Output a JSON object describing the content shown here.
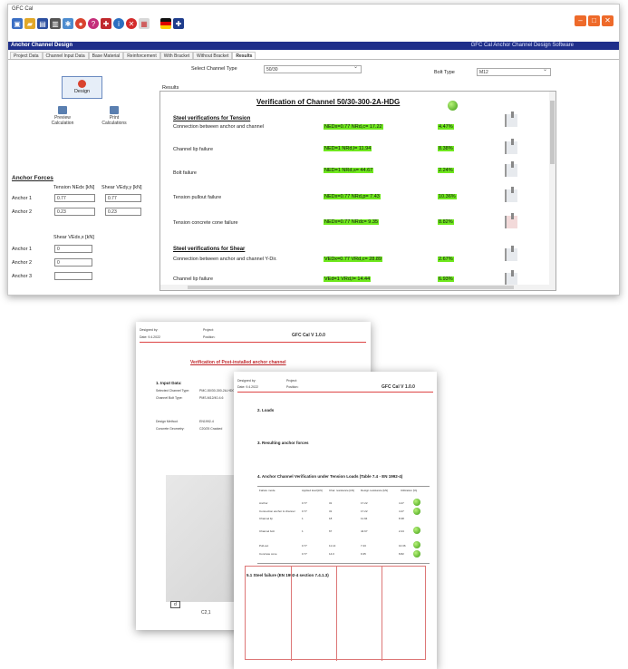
{
  "window": {
    "title": "GFC Cal"
  },
  "header": {
    "app_title": "Anchor Channel Design",
    "right_title": "GFC Cal Anchor Channel Design Software"
  },
  "tabs": [
    "Project Data",
    "Channel Input Data",
    "Base Material",
    "Reinforcement",
    "With Bracket",
    "Without Bracket",
    "Results"
  ],
  "selectors": {
    "channel_label": "Select Channel Type",
    "channel_value": "50/30",
    "bolt_label": "Bolt Type",
    "bolt_value": "M12"
  },
  "buttons": {
    "design": "Design",
    "preview": "Preview\nCalculation",
    "print": "Print\nCalculations"
  },
  "anchor_forces": {
    "title": "Anchor Forces",
    "tension_header": "Tension NEdx [kN]",
    "shear_header": "Shear VEdy,y [kN]",
    "rows": [
      {
        "label": "Anchor 1",
        "tension": "0.77",
        "shear": "0.77"
      },
      {
        "label": "Anchor 2",
        "tension": "0.23",
        "shear": "0.23"
      }
    ],
    "shear_x_header": "Shear VEdx,x [kN]",
    "shear_x_rows": [
      {
        "label": "Anchor 1",
        "value": "0"
      },
      {
        "label": "Anchor 2",
        "value": "0"
      },
      {
        "label": "Anchor 3",
        "value": ""
      }
    ]
  },
  "results": {
    "label": "Results",
    "verification_title": "Verification of Channel  50/30-300-2A-HDG",
    "tension_section": "Steel verifications for Tension",
    "shear_section": "Steel verifications for Shear",
    "rows": [
      {
        "check": "Connection between anchor and channel",
        "value": "NEDx=0.77  NRd,c= 17.22",
        "pct": "4.47%"
      },
      {
        "check": "Channel lip failure",
        "value": "NED=1  NRd,l= 11.94",
        "pct": "8.38%"
      },
      {
        "check": "Bolt failure",
        "value": "NED=1  NRd,s= 44.67",
        "pct": "2.24%"
      },
      {
        "check": "Tension pullout failure",
        "value": "NEDx=0.77  NRd,p= 7.43",
        "pct": "10.36%"
      },
      {
        "check": "Tension concrete cone failure",
        "value": "NEDx=0.77  NRdc= 9.35",
        "pct": "8.82%"
      },
      {
        "check": "Connection between anchor and channel Y-Dir.",
        "value": "VEDx=0.77  VRd,c= 28.89",
        "pct": "2.67%"
      },
      {
        "check": "Channel lip failure",
        "value": "VEd=1  VRd,l= 14.44",
        "pct": "6.93%"
      }
    ]
  },
  "doc1": {
    "designed_by": "Designed by:",
    "date": "Date: 9.4.2022",
    "project": "Project:",
    "project_val": "Position:",
    "brand": "GFC Cal V 1.0.0",
    "title": "Verification of Post-installed anchor channel",
    "section": "1. Input Data:",
    "rows": [
      "Selected Channel Type:",
      "Channel Bolt Type:",
      "Design Method:",
      "Concrete Geometry:"
    ],
    "vals": [
      "PMC-50/30-300-2A-HDG",
      "PMS-M12/40-4.6",
      "EN1992-4",
      "C20/25 Cracked"
    ],
    "dim1": "d",
    "dim2": "C2,1"
  },
  "doc2": {
    "designed_by": "Designed by:",
    "date": "Date: 9.4.2022",
    "project": "Project:",
    "project_val": "Position:",
    "brand": "GFC Cal V 1.0.0",
    "s2": "2. Loads",
    "s3": "3. Resulting anchor forces",
    "s4": "4. Anchor Channel Verification under Tension Loads (Table 7.4 - EN 1992-4)",
    "table_head": [
      "Failure mode",
      "Applied load [kN]",
      "Char. resistance [kN]",
      "Design resistance [kN]",
      "Utilization [%]"
    ],
    "rows": [
      [
        "Anchor",
        "0.77",
        "31",
        "17.22",
        "4.47"
      ],
      [
        "Connection anchor & channel",
        "0.77",
        "31",
        "17.22",
        "4.47"
      ],
      [
        "Channel lip",
        "1",
        "18",
        "11.94",
        "8.38"
      ],
      [
        "Channel bolt",
        "1",
        "67",
        "44.67",
        "2.24"
      ],
      [
        "Pull-out",
        "0.77",
        "11.14",
        "7.43",
        "10.36"
      ],
      [
        "Concrete cone",
        "0.77",
        "14.0",
        "9.35",
        "8.82"
      ]
    ],
    "s5": "5.1 Steel failure (EN 1992-4 section 7.4.1.3)"
  }
}
